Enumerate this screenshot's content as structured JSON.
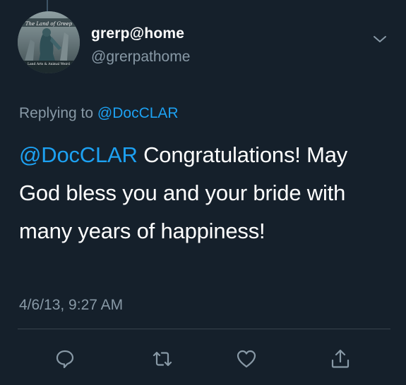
{
  "author": {
    "display_name": "grerp@home",
    "handle": "@grerpathome",
    "avatar_text_top": "The Land of Greep",
    "avatar_text_bottom": "Land Arts & Animal Weird"
  },
  "reply_context": {
    "prefix": "Replying to ",
    "mention": "@DocCLAR"
  },
  "tweet": {
    "mention": "@DocCLAR",
    "body": " Congratulations! May God bless you and your bride with many years of happiness!",
    "timestamp": "4/6/13, 9:27 AM"
  },
  "actions": [
    "reply-icon",
    "retweet-icon",
    "like-icon",
    "share-icon"
  ],
  "colors": {
    "background": "#15202b",
    "text": "#ffffff",
    "secondary": "#8899a6",
    "accent": "#1da1f2",
    "divider": "#38444d"
  }
}
